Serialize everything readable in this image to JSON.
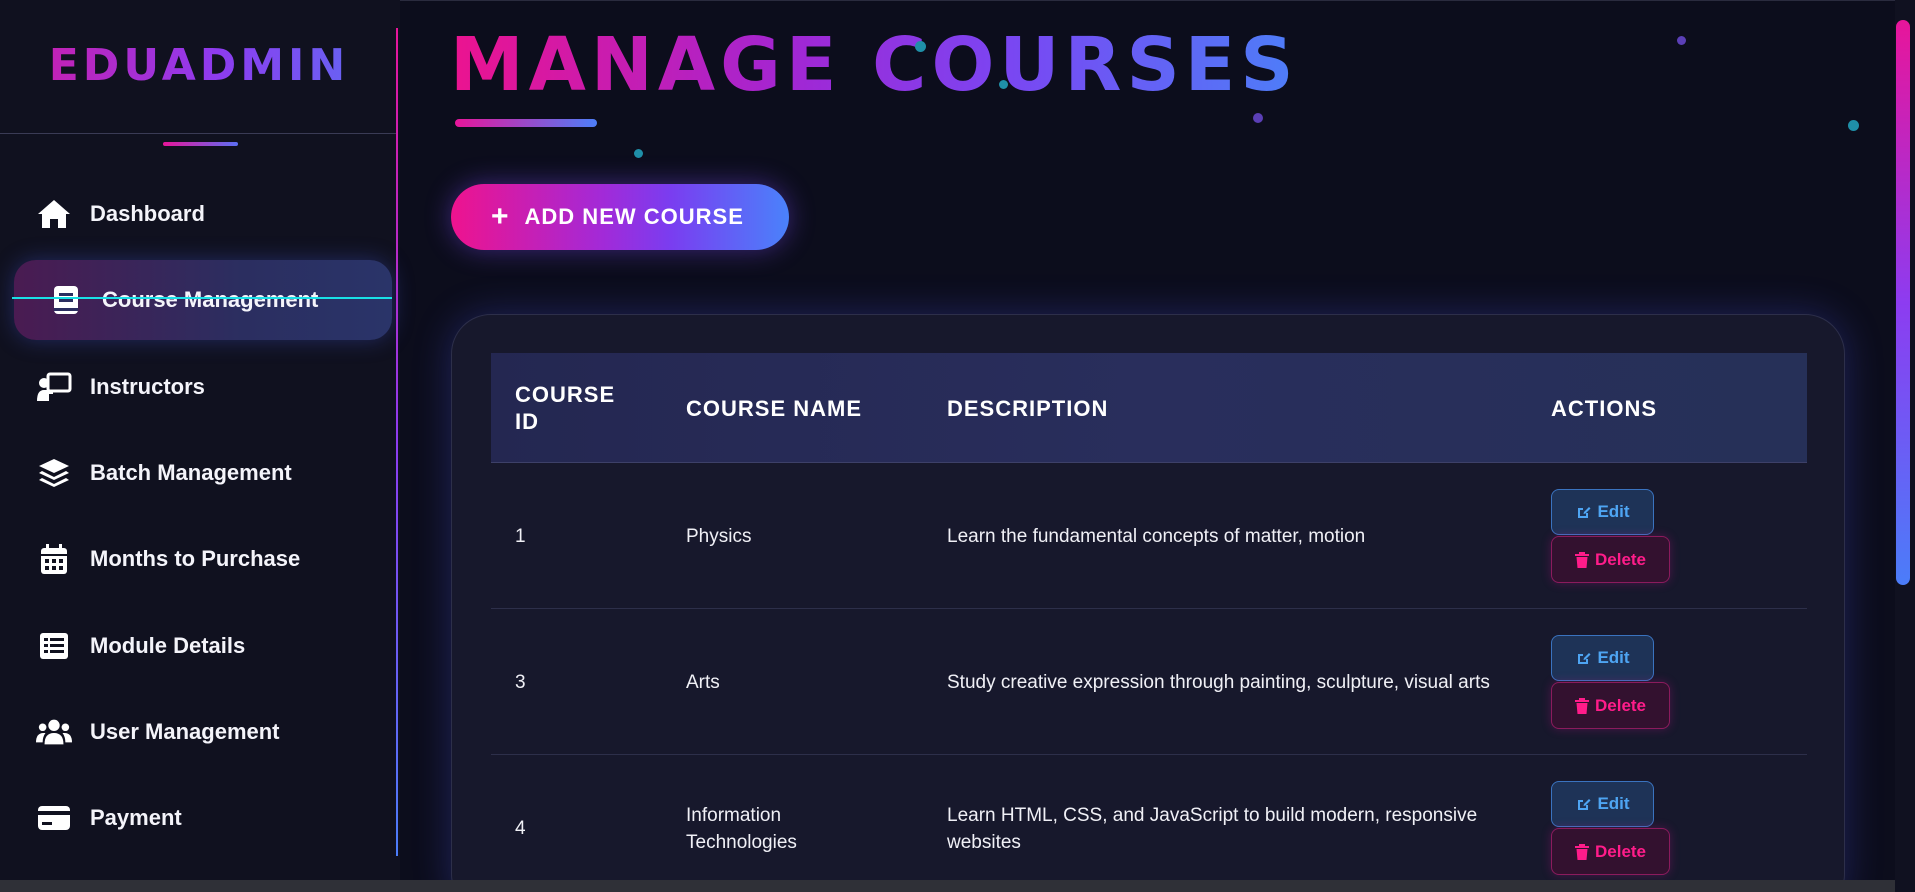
{
  "brand": {
    "name": "EDUADMIN"
  },
  "sidebar": {
    "items": [
      {
        "label": "Dashboard",
        "icon": "home-icon"
      },
      {
        "label": "Course Management",
        "icon": "book-icon",
        "active": true
      },
      {
        "label": "Instructors",
        "icon": "chalkboard-teacher-icon"
      },
      {
        "label": "Batch Management",
        "icon": "layers-icon"
      },
      {
        "label": "Months to Purchase",
        "icon": "calendar-icon"
      },
      {
        "label": "Module Details",
        "icon": "list-icon"
      },
      {
        "label": "User Management",
        "icon": "users-icon"
      },
      {
        "label": "Payment",
        "icon": "credit-card-icon"
      }
    ]
  },
  "main": {
    "title": "MANAGE COURSES",
    "add_button": {
      "icon": "plus-icon",
      "label": "ADD NEW COURSE"
    }
  },
  "table": {
    "headers": [
      "COURSE ID",
      "COURSE NAME",
      "DESCRIPTION",
      "ACTIONS"
    ],
    "rows": [
      {
        "id": "1",
        "name": "Physics",
        "description": "Learn the fundamental concepts of matter, motion"
      },
      {
        "id": "3",
        "name": "Arts",
        "description": "Study creative expression through painting, sculpture, visual arts"
      },
      {
        "id": "4",
        "name": "Information Technologies",
        "description": "Learn HTML, CSS, and JavaScript to build modern, responsive websites"
      }
    ],
    "edit_label": "Edit",
    "delete_label": "Delete"
  },
  "colors": {
    "accent_pink": "#e8159a",
    "accent_purple": "#8d3cf0",
    "accent_blue": "#4b7df9",
    "background": "#0c0d1c",
    "edit_blue": "#4ea5f3",
    "delete_pink": "#ff1c8a"
  }
}
